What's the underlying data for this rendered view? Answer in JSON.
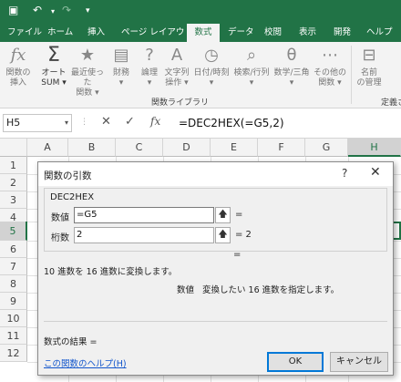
{
  "tabs": [
    {
      "label": "ファイル"
    },
    {
      "label": "ホーム"
    },
    {
      "label": "挿入"
    },
    {
      "label": "ページ レイアウト"
    },
    {
      "label": "数式",
      "active": true
    },
    {
      "label": "データ"
    },
    {
      "label": "校閲"
    },
    {
      "label": "表示"
    },
    {
      "label": "開発"
    },
    {
      "label": "ヘルプ"
    }
  ],
  "ribbon": {
    "insert_fn": {
      "line1": "関数の",
      "line2": "挿入",
      "icon": "fx-icon"
    },
    "autosum": {
      "line1": "オート",
      "line2": "SUM ▾",
      "icon": "sigma-icon"
    },
    "recent": {
      "line1": "最近使った",
      "line2": "関数 ▾",
      "icon": "star-icon"
    },
    "financial": {
      "line1": "財務",
      "line2": "▾",
      "icon": "financial-icon"
    },
    "logical": {
      "line1": "論理",
      "line2": "▾",
      "icon": "logical-icon"
    },
    "text": {
      "line1": "文字列",
      "line2": "操作 ▾",
      "icon": "text-icon"
    },
    "datetime": {
      "line1": "日付/時刻",
      "line2": "▾",
      "icon": "clock-icon"
    },
    "lookup": {
      "line1": "検索/行列",
      "line2": "▾",
      "icon": "lookup-icon"
    },
    "math": {
      "line1": "数学/三角",
      "line2": "▾",
      "icon": "math-icon"
    },
    "more": {
      "line1": "その他の",
      "line2": "関数 ▾",
      "icon": "more-icon"
    },
    "group_label": "関数ライブラリ",
    "name_mgr": {
      "line1": "名前",
      "line2": "の管理",
      "icon": "name-tag-icon"
    },
    "define_label": "定義さ"
  },
  "formula_bar": {
    "name_box": "H5",
    "cancel": "✕",
    "enter": "✓",
    "fx": "fx",
    "formula": "=DEC2HEX(=G5,2)"
  },
  "columns": [
    "A",
    "B",
    "C",
    "D",
    "E",
    "F",
    "G",
    "H"
  ],
  "rows": [
    "1",
    "2",
    "3",
    "4",
    "5",
    "6",
    "7",
    "8",
    "9",
    "10",
    "11",
    "12"
  ],
  "dialog": {
    "title": "関数の引数",
    "help_glyph": "?",
    "close_glyph": "✕",
    "function_name": "DEC2HEX",
    "args": [
      {
        "label": "数値",
        "value": "=G5",
        "result": "="
      },
      {
        "label": "桁数",
        "value": "2",
        "result": "= 2"
      }
    ],
    "result_line": "=",
    "description": "10 進数を 16 進数に変換します。",
    "arg_desc_name": "数値",
    "arg_desc_text": "変換したい 16 進数を指定します。",
    "formula_result_label": "数式の結果 =",
    "help_link": "この関数のヘルプ(H)",
    "ok_label": "OK",
    "cancel_label": "キャンセル"
  }
}
